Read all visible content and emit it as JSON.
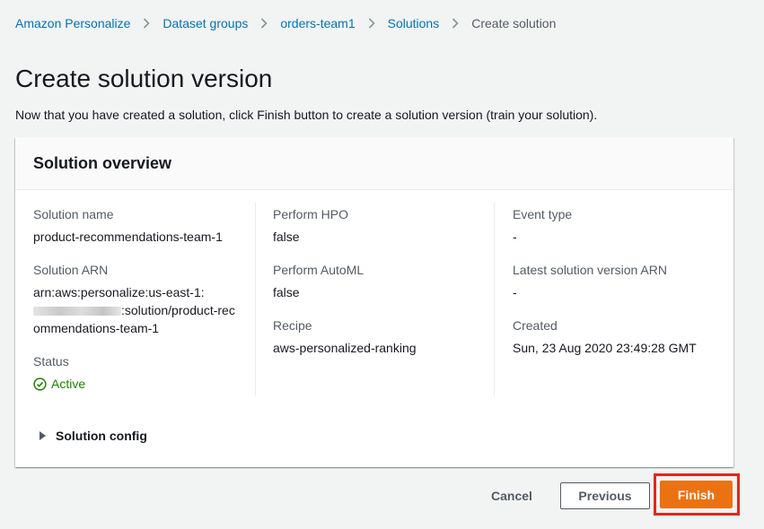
{
  "breadcrumb": {
    "items": [
      {
        "label": "Amazon Personalize"
      },
      {
        "label": "Dataset groups"
      },
      {
        "label": "orders-team1"
      },
      {
        "label": "Solutions"
      }
    ],
    "current": "Create solution"
  },
  "page": {
    "title": "Create solution version",
    "description": "Now that you have created a solution, click Finish button to create a solution version (train your solution)."
  },
  "overview": {
    "title": "Solution overview",
    "solution_name_label": "Solution name",
    "solution_name_value": "product-recommendations-team-1",
    "solution_arn_label": "Solution ARN",
    "solution_arn_prefix": "arn:aws:personalize:us-east-1:",
    "solution_arn_suffix": ":solution/product-recommendations-team-1",
    "status_label": "Status",
    "status_value": "Active",
    "status_color": "#1d8102",
    "perform_hpo_label": "Perform HPO",
    "perform_hpo_value": "false",
    "perform_automl_label": "Perform AutoML",
    "perform_automl_value": "false",
    "recipe_label": "Recipe",
    "recipe_value": "aws-personalized-ranking",
    "event_type_label": "Event type",
    "event_type_value": "-",
    "latest_version_label": "Latest solution version ARN",
    "latest_version_value": "-",
    "created_label": "Created",
    "created_value": "Sun, 23 Aug 2020 23:49:28 GMT",
    "config_label": "Solution config"
  },
  "actions": {
    "cancel_label": "Cancel",
    "previous_label": "Previous",
    "finish_label": "Finish",
    "finish_color": "#ec7211",
    "highlight_color": "#e8231a"
  }
}
